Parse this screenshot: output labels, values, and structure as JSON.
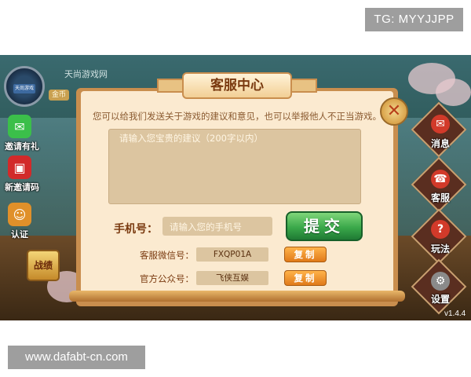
{
  "watermarks": {
    "telegram": "TG: MYYJJPP",
    "site": "www.dafabt-cn.com"
  },
  "lobby": {
    "player_name": "天尚游戏网",
    "avatar_text": "天尚游戏",
    "gold_tag": "金币",
    "left_buttons": [
      {
        "label": "邀请有礼",
        "icon": "wechat-icon",
        "color": "#3bbf4a",
        "glyph": "✉"
      },
      {
        "label": "新邀请码",
        "icon": "red-envelope-icon",
        "color": "#d22a2a",
        "glyph": "▣"
      },
      {
        "label": "认证",
        "icon": "id-card-icon",
        "color": "#e0902a",
        "glyph": "☺"
      }
    ],
    "battle_label": "战绩",
    "right_buttons": [
      {
        "label": "消息",
        "icon": "message-icon",
        "glyph": "✉"
      },
      {
        "label": "客服",
        "icon": "customer-service-icon",
        "glyph": "☎"
      },
      {
        "label": "玩法",
        "icon": "help-icon",
        "glyph": "?"
      },
      {
        "label": "设置",
        "icon": "settings-icon",
        "glyph": "⚙"
      }
    ],
    "version": "v1.4.4"
  },
  "dialog": {
    "title": "客服中心",
    "close_glyph": "✕",
    "description": "您可以给我们发送关于游戏的建议和意见，也可以举报他人不正当游戏。",
    "advice_placeholder": "请输入您宝贵的建议（200字以内）",
    "phone_label": "手机号：",
    "phone_placeholder": "请输入您的手机号",
    "submit_label": "提交",
    "wechat_label": "客服微信号：",
    "wechat_value": "FXQP01A",
    "public_label": "官方公众号：",
    "public_value": "飞侠互娱",
    "copy_label": "复制"
  }
}
